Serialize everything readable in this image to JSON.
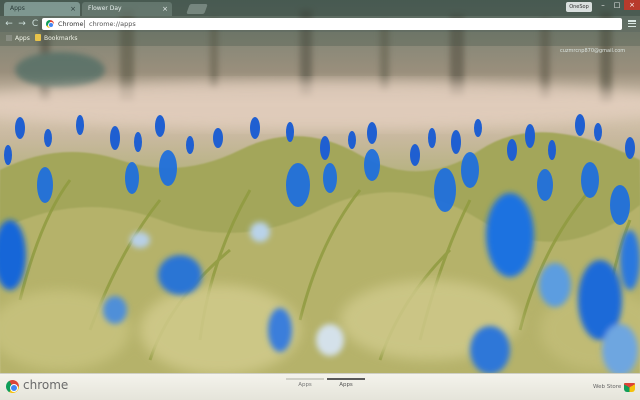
{
  "tabs": [
    {
      "label": "Apps",
      "active": true
    },
    {
      "label": "Flower Day",
      "active": false
    }
  ],
  "tab_close": "×",
  "user_badge": "OneSop",
  "window_controls": {
    "minimize": "–",
    "maximize": "□",
    "close": "×"
  },
  "toolbar": {
    "back": "←",
    "forward": "→",
    "reload": "C",
    "omnibox_label": "Chrome",
    "omnibox_url": "chrome://apps"
  },
  "bookmarks": [
    {
      "label": "Apps",
      "icon": "apps-grid-icon"
    },
    {
      "label": "Bookmarks",
      "icon": "folder-icon"
    }
  ],
  "account_email": "cuzmrcnp870@gmail.com",
  "bottom_bar": {
    "brand": "chrome",
    "pages": [
      {
        "label": "Apps",
        "active": false
      },
      {
        "label": "Apps",
        "active": true
      }
    ],
    "web_store": "Web Store"
  },
  "colors": {
    "flower_blue": "#1e6fd6",
    "stem_green": "#9aa24a",
    "bottom_bar": "#f1f0e8",
    "close_red": "#b83a2c"
  }
}
